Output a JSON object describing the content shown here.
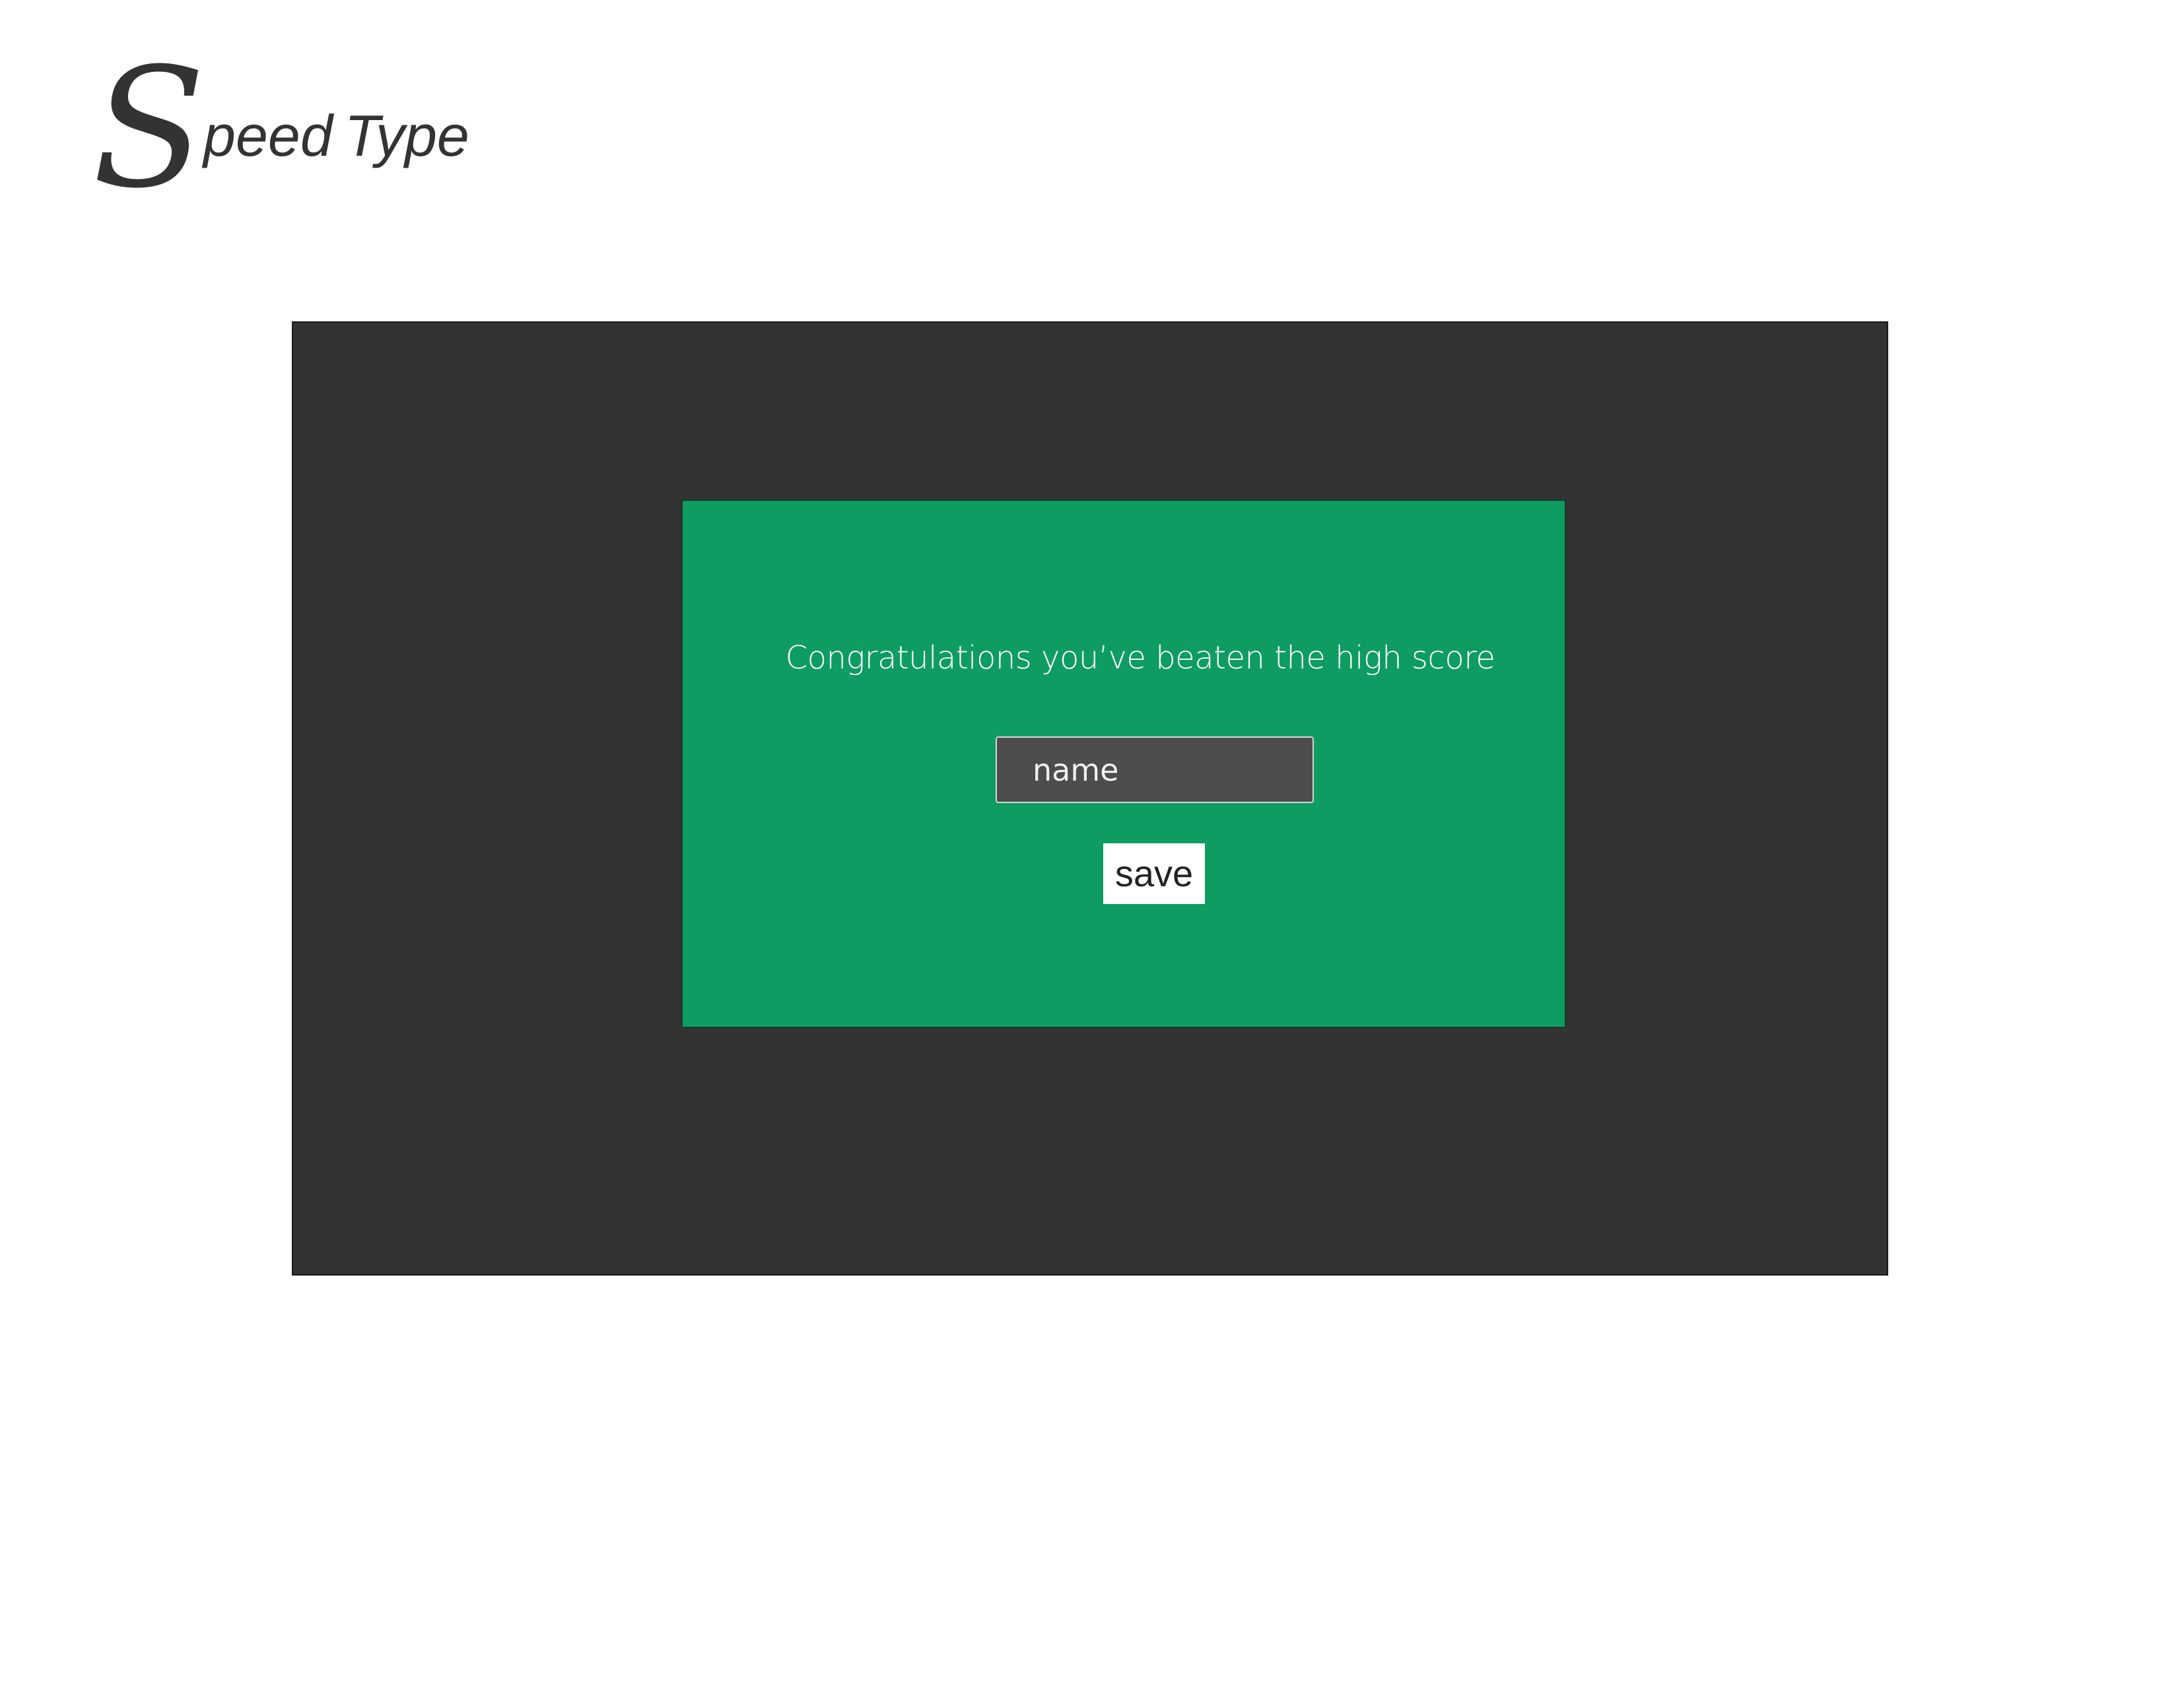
{
  "logo": {
    "initial": "S",
    "text_rest": "peed",
    "text_second": "Type"
  },
  "dialog": {
    "message": "Congratulations you’ve beaten the high score",
    "name_input": {
      "placeholder": "name",
      "value": ""
    },
    "save_label": "save"
  },
  "colors": {
    "page_background": "#ffffff",
    "panel_background": "#333333",
    "dialog_background": "#0e9c63",
    "input_background": "#4d4d4d",
    "button_background": "#ffffff",
    "logo_color": "#333333"
  }
}
